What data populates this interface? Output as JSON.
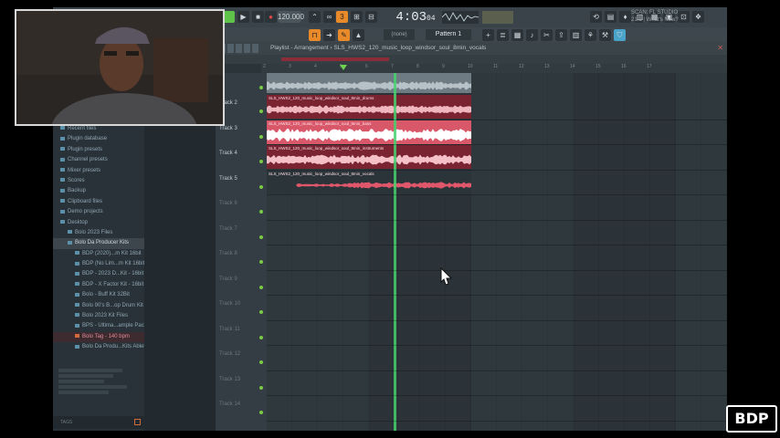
{
  "toolbar": {
    "tempo": "120.000",
    "time_main": "4:03",
    "time_sub": "04",
    "news": "SCAN: FL STUDIO 21.1 | What's New?"
  },
  "toolbar2": {
    "snap": "(none)",
    "pattern": "Pattern 1"
  },
  "browser": {
    "items": [
      {
        "label": "Recent files",
        "state": "normal"
      },
      {
        "label": "Plugin database",
        "state": "normal"
      },
      {
        "label": "Plugin presets",
        "state": "normal"
      },
      {
        "label": "Channel presets",
        "state": "normal"
      },
      {
        "label": "Mixer presets",
        "state": "normal"
      },
      {
        "label": "Scores",
        "state": "normal"
      },
      {
        "label": "Backup",
        "state": "normal"
      },
      {
        "label": "Clipboard files",
        "state": "normal"
      },
      {
        "label": "Demo projects",
        "state": "normal"
      },
      {
        "label": "Desktop",
        "state": "normal"
      },
      {
        "label": "Bolo 2023 Files",
        "state": "normal"
      },
      {
        "label": "Bolo Da Producer Kits",
        "state": "sel"
      },
      {
        "label": "BDP (2020)...m Kit 16bit",
        "state": "normal"
      },
      {
        "label": "BDP (No Lim...m Kit 16bit",
        "state": "normal"
      },
      {
        "label": "BDP - 2023 D...Kit - 16bit",
        "state": "normal"
      },
      {
        "label": "BDP - X Factor Kit - 16bit",
        "state": "normal"
      },
      {
        "label": "Bolo - Buff Kit 32Bit",
        "state": "normal"
      },
      {
        "label": "Bolo 90's B...op Drum Kit",
        "state": "normal"
      },
      {
        "label": "Bolo 2023 Kit Files",
        "state": "normal"
      },
      {
        "label": "BPS - Ultima...ample Pack",
        "state": "normal"
      },
      {
        "label": "Bolo Tag - 140 bpm",
        "state": "hl"
      },
      {
        "label": "Bolo Da Produ...Kits Ableton",
        "state": "normal"
      }
    ],
    "tags": "TAGS"
  },
  "playlist": {
    "title": "Playlist - Arrangement › SLS_HWS2_120_music_loop_windsor_soul_8min_vocals",
    "ruler_ticks": [
      "2",
      "3",
      "4",
      "5",
      "6",
      "7",
      "8",
      "9",
      "10",
      "11",
      "12",
      "13",
      "14",
      "15",
      "16",
      "17"
    ],
    "tracks": [
      "Track 2",
      "Track 3",
      "Track 4",
      "Track 5",
      "Track 6",
      "Track 7",
      "Track 8",
      "Track 9",
      "Track 10",
      "Track 11",
      "Track 12",
      "Track 13",
      "Track 14"
    ],
    "clips": [
      {
        "label": "",
        "color": "#6e7b83"
      },
      {
        "label": "SLS_HWS2_120_music_loop_windsor_soul_8min_drums",
        "color": "#7a2432"
      },
      {
        "label": "SLS_HWS2_120_music_loop_windsor_soul_8min_bass",
        "color": "#d8586a"
      },
      {
        "label": "SLS_HWS2_120_music_loop_windsor_soul_8min_instruments",
        "color": "#7a2432"
      },
      {
        "label": "SLS_HWS2_120_music_loop_windsor_soul_8min_vocals",
        "color": "#2b3439"
      }
    ]
  },
  "logo": "BDP"
}
